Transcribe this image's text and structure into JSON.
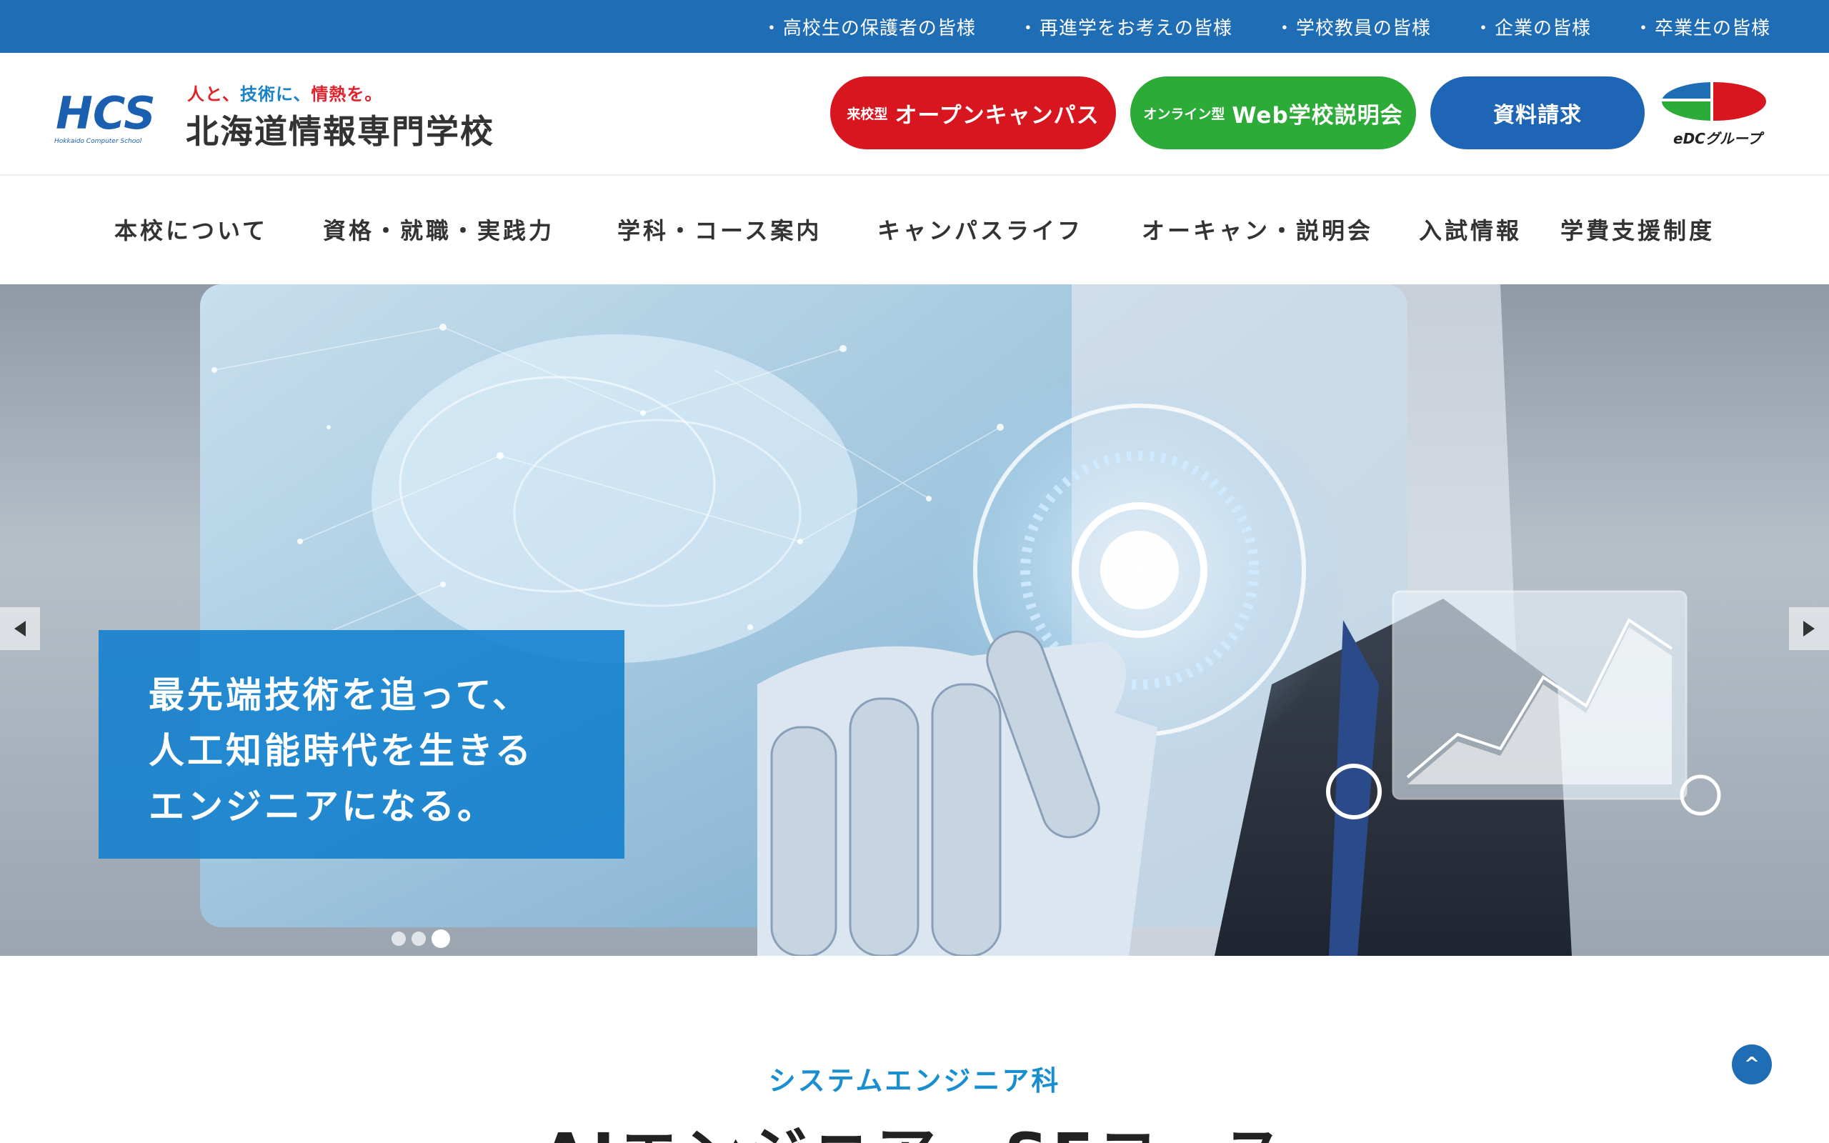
{
  "topbar": {
    "links": [
      "高校生の保護者の皆様",
      "再進学をお考えの皆様",
      "学校教員の皆様",
      "企業の皆様",
      "卒業生の皆様"
    ]
  },
  "header": {
    "logo_mark_text": "HCS",
    "logo_mark_sub": "Hokkaido Computer School",
    "tagline_part1": "人と、",
    "tagline_part2": "技術に、",
    "tagline_part3": "情熱を。",
    "school_name": "北海道情報専門学校",
    "buttons": {
      "open_campus_small": "来校型",
      "open_campus_label": "オープンキャンパス",
      "web_session_small": "オンライン型",
      "web_session_label": "Web学校説明会",
      "request_docs_label": "資料請求"
    },
    "group_label": "eDCグループ"
  },
  "nav": {
    "items": [
      "本校について",
      "資格・就職・実践力",
      "学科・コース案内",
      "キャンパスライフ",
      "オーキャン・説明会",
      "入試情報",
      "学費支援制度"
    ]
  },
  "hero": {
    "caption_lines": [
      "最先端技術を追って、",
      "人工知能時代を生きる",
      "エンジニアになる。"
    ],
    "slide_count": 3,
    "active_slide": 3
  },
  "section": {
    "subtitle": "システムエンジニア科",
    "title": "AIエンジニア・SEコース"
  },
  "to_top_label": "^",
  "colors": {
    "topbar": "#1f6db5",
    "open_campus": "#d8161f",
    "web_session": "#2cab38",
    "request_docs": "#1e66b5",
    "caption_bg": "#1080ce",
    "accent_text": "#1a8fd0"
  }
}
